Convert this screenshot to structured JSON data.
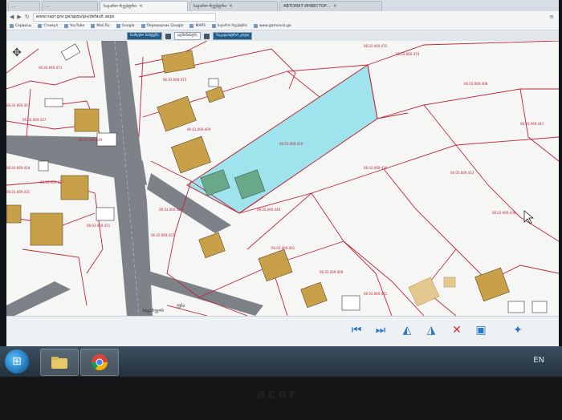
{
  "browser": {
    "tabs": [
      {
        "label": "...",
        "active": false
      },
      {
        "label": "...",
        "active": false
      },
      {
        "label": "საჯარო რეესტრი",
        "active": true
      },
      {
        "label": "საჯარო რეესტრი",
        "active": false
      },
      {
        "label": "АВТОМАТ ИНВЕСТОР...",
        "active": false
      }
    ],
    "tab_close_glyph": "×",
    "url": "www.napr.gov.ge/apps/gis/default.aspx",
    "bookmarks": [
      "Сервисы",
      "Стимул",
      "YouTube",
      "Mail.Ru",
      "Google",
      "Переводчик Google",
      "MAPS",
      "საჯარო რეესტრი",
      "www.gamoivla.ge"
    ]
  },
  "app_toolbar": {
    "search_value": "საძიებო სისტემა",
    "field2": "ადმინისტრ.",
    "field3": "საკადასტრო კოდი"
  },
  "map": {
    "parcel_labels": [
      "06.03.069.471",
      "06.03.069.473",
      "06.03.069.475",
      "06.03.069.474",
      "06.03.069.408",
      "06.03.069.407",
      "06.03.069.437",
      "06.03.069.449",
      "06.03.069.409",
      "06.03.069.420",
      "06.03.069.441",
      "06.03.069.418",
      "06.03.069.427",
      "06.03.069.410",
      "06.03.069.413",
      "06.03.069.431",
      "06.03.069.406",
      "06.03.069.440",
      "06.03.069.438",
      "06.03.069.431",
      "06.03.069.437",
      "06.03.069.401",
      "06.03.069.409",
      "06.03.069.411"
    ],
    "street_label_1": "საგარეჯოს",
    "street_label_2": "ქუჩა"
  },
  "bottom_tools": [
    {
      "name": "first-page-icon",
      "glyph": "⏮"
    },
    {
      "name": "last-page-icon",
      "glyph": "⏭"
    },
    {
      "name": "measure-area-icon",
      "glyph": "◭"
    },
    {
      "name": "measure-line-icon",
      "glyph": "◮"
    },
    {
      "name": "clear-icon",
      "glyph": "✕"
    },
    {
      "name": "print-icon",
      "glyph": "▣"
    },
    {
      "name": "full-extent-icon",
      "glyph": "✦"
    }
  ],
  "taskbar": {
    "language": "EN"
  },
  "monitor": {
    "brand": "acer"
  },
  "colors": {
    "selected_parcel": "#9fe3ec",
    "road": "#7d8288",
    "parcel_border": "#c0253c",
    "building": "#c8a04a"
  }
}
